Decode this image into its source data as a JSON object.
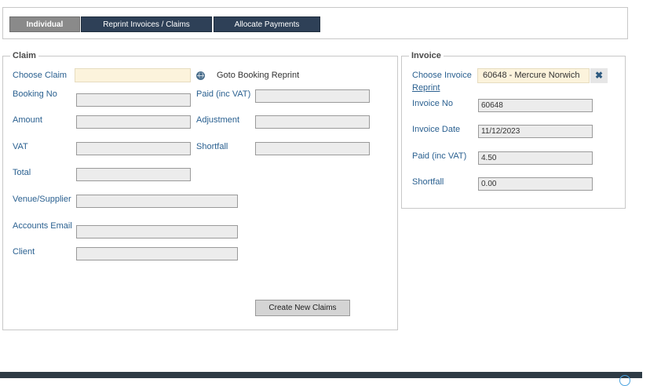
{
  "tabs": [
    {
      "label": "Individual"
    },
    {
      "label": "Reprint Invoices / Claims"
    },
    {
      "label": "Allocate Payments"
    }
  ],
  "claim": {
    "legend": "Claim",
    "choose_claim_label": "Choose Claim",
    "choose_claim_value": "",
    "goto_label": "Goto Booking Reprint",
    "booking_no_label": "Booking No",
    "paid_label": "Paid (inc VAT)",
    "amount_label": "Amount",
    "adjustment_label": "Adjustment",
    "vat_label": "VAT",
    "shortfall_label": "Shortfall",
    "total_label": "Total",
    "venue_label": "Venue/Supplier",
    "accounts_email_label": "Accounts Email",
    "client_label": "Client",
    "create_button": "Create New Claims"
  },
  "invoice": {
    "legend": "Invoice",
    "choose_invoice_label": "Choose Invoice",
    "choose_invoice_value": "60648 - Mercure Norwich",
    "reprint_link": "Reprint",
    "invoice_no_label": "Invoice No",
    "invoice_no_value": "60648",
    "invoice_date_label": "Invoice Date",
    "invoice_date_value": "11/12/2023",
    "paid_label": "Paid (inc VAT)",
    "paid_value": "4.50",
    "shortfall_label": "Shortfall",
    "shortfall_value": "0.00",
    "clear_glyph": "✖"
  }
}
